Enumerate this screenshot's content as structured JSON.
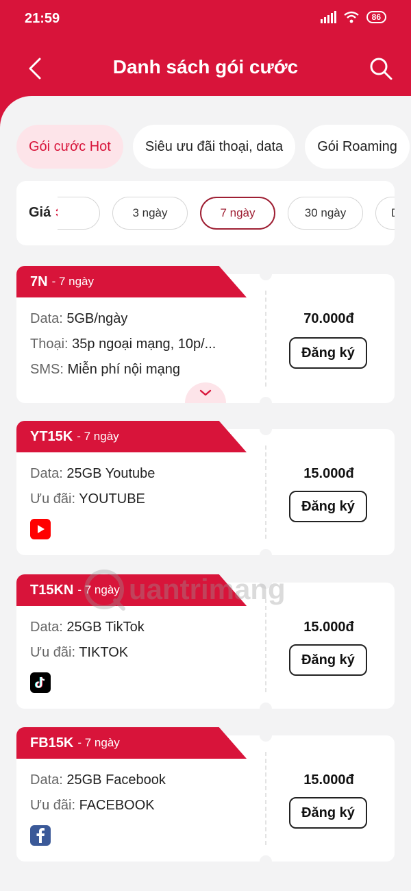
{
  "status_bar": {
    "time": "21:59",
    "battery": "86"
  },
  "header": {
    "title": "Danh sách gói cước"
  },
  "category_tabs": [
    {
      "label": "Gói cước Hot"
    },
    {
      "label": "Siêu ưu đãi thoại, data"
    },
    {
      "label": "Gói Roaming"
    }
  ],
  "filter": {
    "sort_label": "Giá",
    "chips": [
      {
        "label": "3 ngày"
      },
      {
        "label": "7 ngày"
      },
      {
        "label": "30 ngày"
      },
      {
        "label": "D"
      }
    ]
  },
  "packages": [
    {
      "code": "7N",
      "duration": "- 7 ngày",
      "lines": [
        {
          "label": "Data:",
          "value": "5GB/ngày"
        },
        {
          "label": "Thoại:",
          "value": "35p ngoại mạng, 10p/..."
        },
        {
          "label": "SMS:",
          "value": "Miễn phí nội mạng"
        }
      ],
      "price": "70.000đ",
      "register_label": "Đăng ký"
    },
    {
      "code": "YT15K",
      "duration": "- 7 ngày",
      "lines": [
        {
          "label": "Data:",
          "value": "25GB Youtube"
        },
        {
          "label": "Ưu đãi:",
          "value": "YOUTUBE"
        }
      ],
      "price": "15.000đ",
      "register_label": "Đăng ký",
      "app_icon": "youtube-icon"
    },
    {
      "code": "T15KN",
      "duration": "- 7 ngày",
      "lines": [
        {
          "label": "Data:",
          "value": "25GB TikTok"
        },
        {
          "label": "Ưu đãi:",
          "value": "TIKTOK"
        }
      ],
      "price": "15.000đ",
      "register_label": "Đăng ký",
      "app_icon": "tiktok-icon"
    },
    {
      "code": "FB15K",
      "duration": "- 7 ngày",
      "lines": [
        {
          "label": "Data:",
          "value": "25GB Facebook"
        },
        {
          "label": "Ưu đãi:",
          "value": "FACEBOOK"
        }
      ],
      "price": "15.000đ",
      "register_label": "Đăng ký",
      "app_icon": "facebook-icon"
    }
  ],
  "watermark": "uantrimang",
  "colors": {
    "brand": "#d8143a",
    "chip_active": "#9e1f33",
    "tab_active_bg": "#fde4e9"
  }
}
